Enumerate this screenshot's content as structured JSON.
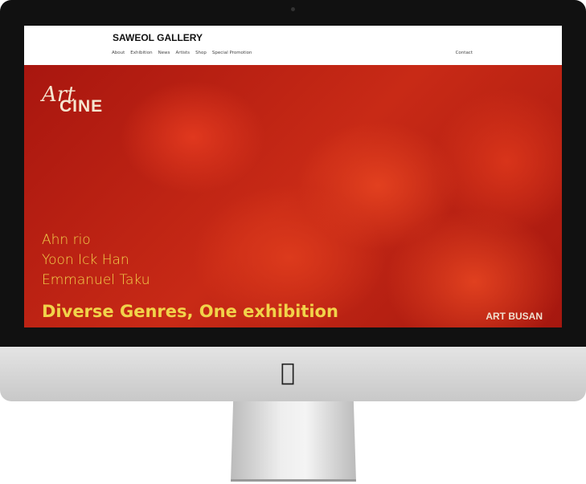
{
  "site": {
    "brand": "SAWEOL GALLERY",
    "menu": [
      "About",
      "Exhibition",
      "News",
      "Artists",
      "Shop",
      "Special Promotion"
    ],
    "contact": "Contact"
  },
  "banner": {
    "logo_art": "Art",
    "logo_cine": "CINE",
    "artists": [
      "Ahn rio",
      "Yoon Ick Han",
      "Emmanuel Taku"
    ],
    "tagline": "Diverse Genres, One exhibition",
    "event": "ART BUSAN"
  },
  "device": {
    "logo_icon": "apple-logo-icon"
  }
}
